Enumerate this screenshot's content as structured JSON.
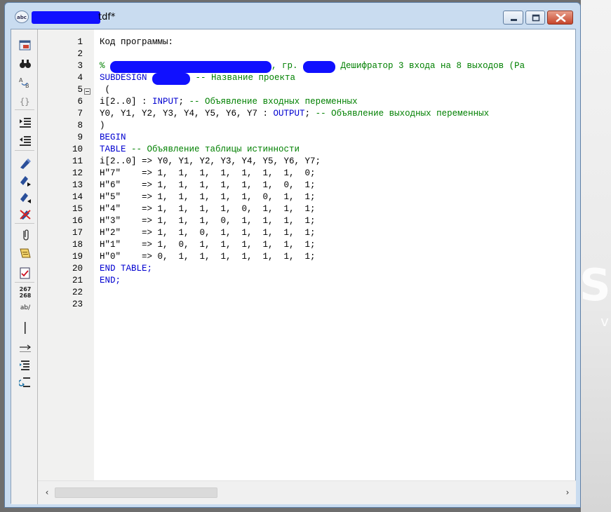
{
  "window": {
    "title": "tdf*",
    "app_icon_text": "abc"
  },
  "desktop": {
    "big_text": "S",
    "small_text": "v"
  },
  "toolbar": {
    "buttons": [
      "insert-file-icon",
      "find-icon",
      "replace-icon",
      "insert-brackets-icon",
      "indent-icon",
      "unindent-icon",
      "bookmark-set-icon",
      "bookmark-next-icon",
      "bookmark-prev-icon",
      "bookmark-clear-icon",
      "attach-icon",
      "template-icon",
      "checklist-icon",
      "line-numbers-icon",
      "spell-icon",
      "cursor-line-icon",
      "show-tabs-icon",
      "word-wrap-icon",
      "wrap-back-icon"
    ],
    "line_numbers_label_top": "267",
    "line_numbers_label_bottom": "268",
    "spell_label": "ab/"
  },
  "editor": {
    "line_numbers": [
      "1",
      "2",
      "3",
      "4",
      "5",
      "6",
      "7",
      "8",
      "9",
      "10",
      "11",
      "12",
      "13",
      "14",
      "15",
      "16",
      "17",
      "18",
      "19",
      "20",
      "21",
      "22",
      "23"
    ],
    "lines": [
      {
        "segs": [
          {
            "t": "Код программы:"
          }
        ]
      },
      {
        "segs": []
      },
      {
        "segs": [
          {
            "t": "% ",
            "c": "cm"
          },
          {
            "r": 230
          },
          {
            "t": ", гр. ",
            "c": "cm"
          },
          {
            "r": 46
          },
          {
            "t": " Дешифратор 3 входа на 8 выходов (Ра",
            "c": "cm"
          }
        ]
      },
      {
        "segs": [
          {
            "t": "SUBDESIGN ",
            "c": "kw"
          },
          {
            "r": 54
          },
          {
            "t": " -- Название проекта",
            "c": "cm"
          }
        ]
      },
      {
        "segs": [
          {
            "t": " ("
          }
        ]
      },
      {
        "segs": [
          {
            "t": "i[2..0] : "
          },
          {
            "t": "INPUT",
            "c": "kw"
          },
          {
            "t": "; "
          },
          {
            "t": "-- Объявление входных переменных",
            "c": "cm"
          }
        ]
      },
      {
        "segs": [
          {
            "t": "Y0, Y1, Y2, Y3, Y4, Y5, Y6, Y7 : "
          },
          {
            "t": "OUTPUT",
            "c": "kw"
          },
          {
            "t": "; "
          },
          {
            "t": "-- Объявление выходных переменных",
            "c": "cm"
          }
        ]
      },
      {
        "segs": [
          {
            "t": ")"
          }
        ]
      },
      {
        "segs": [
          {
            "t": "BEGIN",
            "c": "kw"
          }
        ]
      },
      {
        "segs": [
          {
            "t": "TABLE",
            "c": "kw"
          },
          {
            "t": " -- Объявление таблицы истинности",
            "c": "cm"
          }
        ]
      },
      {
        "segs": [
          {
            "t": "i[2..0] => Y0, Y1, Y2, Y3, Y4, Y5, Y6, Y7;"
          }
        ]
      },
      {
        "segs": [
          {
            "t": "H\"7\"    => 1,  1,  1,  1,  1,  1,  1,  0;"
          }
        ]
      },
      {
        "segs": [
          {
            "t": "H\"6\"    => 1,  1,  1,  1,  1,  1,  0,  1;"
          }
        ]
      },
      {
        "segs": [
          {
            "t": "H\"5\"    => 1,  1,  1,  1,  1,  0,  1,  1;"
          }
        ]
      },
      {
        "segs": [
          {
            "t": "H\"4\"    => 1,  1,  1,  1,  0,  1,  1,  1;"
          }
        ]
      },
      {
        "segs": [
          {
            "t": "H\"3\"    => 1,  1,  1,  0,  1,  1,  1,  1;"
          }
        ]
      },
      {
        "segs": [
          {
            "t": "H\"2\"    => 1,  1,  0,  1,  1,  1,  1,  1;"
          }
        ]
      },
      {
        "segs": [
          {
            "t": "H\"1\"    => 1,  0,  1,  1,  1,  1,  1,  1;"
          }
        ]
      },
      {
        "segs": [
          {
            "t": "H\"0\"    => 0,  1,  1,  1,  1,  1,  1,  1;"
          }
        ]
      },
      {
        "segs": [
          {
            "t": "END TABLE;",
            "c": "kw"
          }
        ]
      },
      {
        "segs": [
          {
            "t": "END;",
            "c": "kw"
          }
        ]
      },
      {
        "segs": []
      },
      {
        "segs": []
      }
    ]
  },
  "scrollbar": {
    "left_arrow": "‹",
    "right_arrow": "›"
  },
  "colors": {
    "keyword": "#0000d0",
    "comment": "#008000",
    "redaction": "#1010ff"
  }
}
